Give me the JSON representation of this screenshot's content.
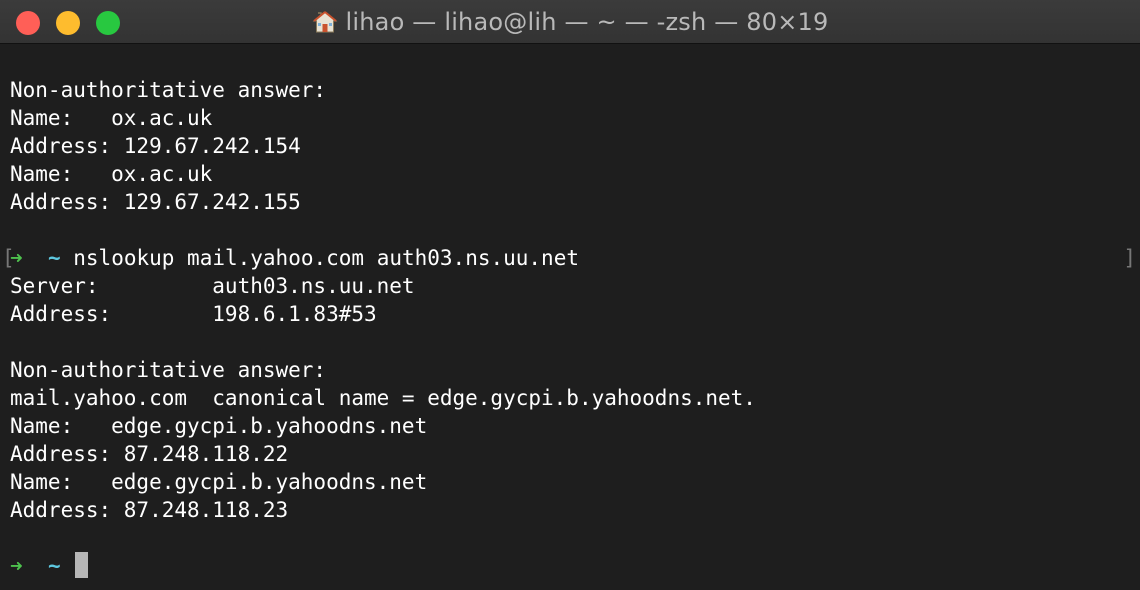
{
  "window": {
    "title": "lihao — lihao@lih — ~ — -zsh — 80×19",
    "home_icon": "home-icon"
  },
  "terminal": {
    "lines": [
      "",
      "Non-authoritative answer:",
      "Name:   ox.ac.uk",
      "Address: 129.67.242.154",
      "Name:   ox.ac.uk",
      "Address: 129.67.242.155",
      "",
      "__prompt_cmd__",
      "Server:         auth03.ns.uu.net",
      "Address:        198.6.1.83#53",
      "",
      "Non-authoritative answer:",
      "mail.yahoo.com  canonical name = edge.gycpi.b.yahoodns.net.",
      "Name:   edge.gycpi.b.yahoodns.net",
      "Address: 87.248.118.22",
      "Name:   edge.gycpi.b.yahoodns.net",
      "Address: 87.248.118.23",
      "",
      "__prompt_idle__"
    ],
    "prompt": {
      "arrow": "➜",
      "cwd": "~",
      "command": "nslookup mail.yahoo.com auth03.ns.uu.net",
      "mark_left": "[",
      "mark_right": "]"
    },
    "colors": {
      "background": "#1e1e1e",
      "text": "#ffffff",
      "arrow": "#4ec24e",
      "cwd": "#5ec8e0",
      "cursor": "#b6b6b6"
    }
  }
}
